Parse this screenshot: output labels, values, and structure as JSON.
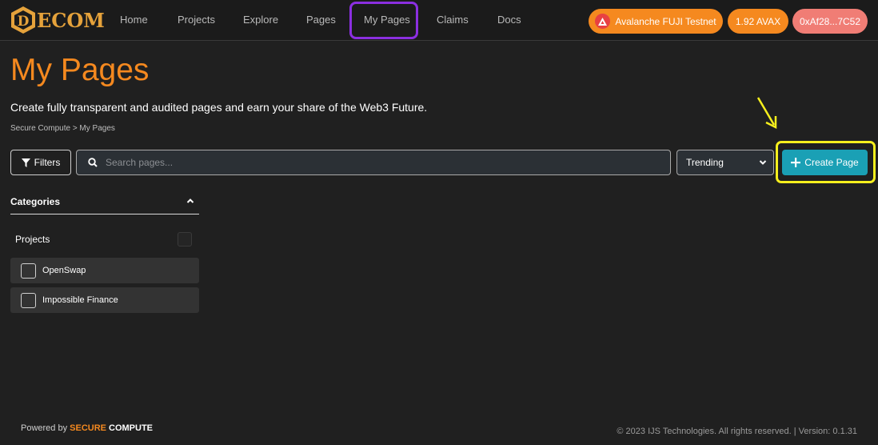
{
  "brand": {
    "logo_text": "ECOM",
    "logo_letter": "D",
    "accent_color": "#f5891f"
  },
  "nav": {
    "items": [
      {
        "label": "Home"
      },
      {
        "label": "Projects"
      },
      {
        "label": "Explore"
      },
      {
        "label": "Pages"
      },
      {
        "label": "My Pages",
        "active": true
      },
      {
        "label": "Claims"
      },
      {
        "label": "Docs"
      }
    ]
  },
  "wallet": {
    "network": "Avalanche FUJI Testnet",
    "network_icon": "avalanche-icon",
    "balance": "1.92 AVAX",
    "address": "0xAf28...7C52"
  },
  "page": {
    "title": "My Pages",
    "subtitle": "Create fully transparent and audited pages and earn your share of the Web3 Future.",
    "breadcrumb": "Secure Compute > My Pages"
  },
  "toolbar": {
    "filters_label": "Filters",
    "search_placeholder": "Search pages...",
    "search_value": "",
    "sort_selected": "Trending",
    "create_label": "Create Page"
  },
  "sidebar": {
    "categories_title": "Categories",
    "group_label": "Projects",
    "items": [
      {
        "label": "OpenSwap",
        "checked": false
      },
      {
        "label": "Impossible Finance",
        "checked": false
      }
    ]
  },
  "footer": {
    "powered_by": "Powered by",
    "brand_a": "SECURE",
    "brand_b": "COMPUTE",
    "copyright": "© 2023 IJS Technologies. All rights reserved. | Version: 0.1.31"
  },
  "annotations": {
    "highlight_nav_color": "#8b2fe0",
    "highlight_button_color": "#f6ef1d"
  }
}
